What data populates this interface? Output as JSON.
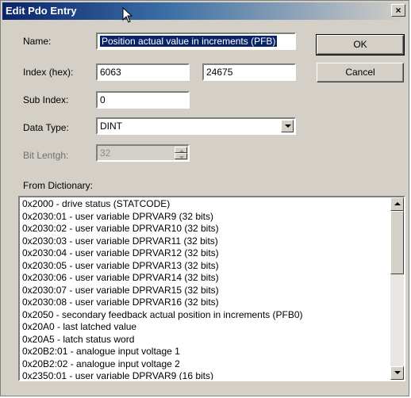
{
  "window": {
    "title": "Edit Pdo Entry",
    "close_glyph": "×"
  },
  "fields": {
    "name_label": "Name:",
    "name_value": "Position actual value in increments (PFB)",
    "index_label": "Index (hex):",
    "index_value": "6063",
    "index_decimal_value": "24675",
    "subindex_label": "Sub Index:",
    "subindex_value": "0",
    "datatype_label": "Data Type:",
    "datatype_value": "DINT",
    "bitlength_label": "Bit Lentgh:",
    "bitlength_value": "32"
  },
  "buttons": {
    "ok": "OK",
    "cancel": "Cancel"
  },
  "dictionary": {
    "label": "From Dictionary:",
    "items": [
      "0x2000 - drive status (STATCODE)",
      "0x2030:01 - user variable DPRVAR9 (32 bits)",
      "0x2030:02 - user variable DPRVAR10 (32 bits)",
      "0x2030:03 - user variable DPRVAR11 (32 bits)",
      "0x2030:04 - user variable DPRVAR12 (32 bits)",
      "0x2030:05 - user variable DPRVAR13 (32 bits)",
      "0x2030:06 - user variable DPRVAR14 (32 bits)",
      "0x2030:07 - user variable DPRVAR15 (32 bits)",
      "0x2030:08 - user variable DPRVAR16 (32 bits)",
      "0x2050 - secondary feedback actual position in increments (PFB0)",
      "0x20A0 - last latched value",
      "0x20A5 - latch status word",
      "0x20B2:01 - analogue input voltage 1",
      "0x20B2:02 - analogue input voltage 2",
      "0x2350:01 - user variable DPRVAR9 (16 bits)"
    ]
  },
  "icons": {
    "close": "close-icon",
    "cursor": "mouse-pointer-icon",
    "combo": "chevron-down-icon",
    "spin": "spin-arrows-icon",
    "scroll_up": "scroll-up-icon",
    "scroll_down": "scroll-down-icon"
  },
  "colors": {
    "titlebar_start": "#0a246a",
    "titlebar_end": "#d4d0c8",
    "selection": "#0a246a",
    "dialog_face": "#d4d0c8"
  }
}
